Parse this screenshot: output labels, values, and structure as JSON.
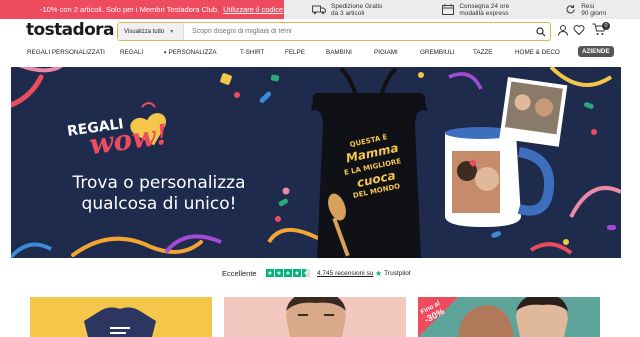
{
  "promo": {
    "offer_text": "-10% con 2 articoli. Solo per i Membri Tostadora Club.",
    "offer_link": "Utilizzare il codice",
    "items": [
      {
        "icon": "truck-icon",
        "line1": "Spedizione Gratis",
        "line2": "da 3 articoli"
      },
      {
        "icon": "calendar-icon",
        "line1": "Consegna 24 ore",
        "line2": "modalità express"
      },
      {
        "icon": "return-icon",
        "line1": "Resi",
        "line2": "90 giorni"
      }
    ]
  },
  "header": {
    "logo": "tostadora",
    "search_category": "Visualizza tutto",
    "search_placeholder": "Scopri disegni di migliaia di temi",
    "cart_count": "0"
  },
  "nav": {
    "items": [
      "REGALI PERSONALIZZATI",
      "REGALI",
      "PERSONALIZZA",
      "T-SHIRT",
      "FELPE",
      "BAMBINI",
      "PIGIAMI",
      "GREMBIULI",
      "TAZZE",
      "HOME & DECO"
    ],
    "aziende": "AZIENDE"
  },
  "hero": {
    "tag1": "REGALI",
    "tag2": "wow!",
    "title_line1": "Trova o personalizza",
    "title_line2": "qualcosa di unico!",
    "apron_text": [
      "QUESTA È",
      "Mamma",
      "E LA MIGLIORE",
      "cuoca",
      "DEL MONDO"
    ]
  },
  "trust": {
    "label": "Eccellente",
    "reviews": "4.745 recensioni su",
    "brand": "Trustpilot",
    "rating": 4.5
  },
  "cards": {
    "badge": "Fino al",
    "badge2": "-30%"
  },
  "colors": {
    "accent": "#ef4b5f",
    "hero_bg": "#1f2b4d",
    "trust_green": "#00b67a"
  }
}
